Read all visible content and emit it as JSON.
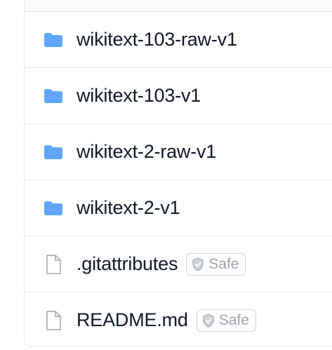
{
  "files": [
    {
      "name": "wikitext-103-raw-v1",
      "type": "folder",
      "icon": "folder-icon"
    },
    {
      "name": "wikitext-103-v1",
      "type": "folder",
      "icon": "folder-icon"
    },
    {
      "name": "wikitext-2-raw-v1",
      "type": "folder",
      "icon": "folder-icon"
    },
    {
      "name": "wikitext-2-v1",
      "type": "folder",
      "icon": "folder-icon"
    },
    {
      "name": ".gitattributes",
      "type": "file",
      "icon": "file-icon",
      "badge": "Safe"
    },
    {
      "name": "README.md",
      "type": "file",
      "icon": "file-icon",
      "badge": "Safe"
    }
  ],
  "colors": {
    "folder": "#60a5fa",
    "file_outline": "#9ca3af",
    "border": "#e5e7eb"
  },
  "badge_icon": "shield-check-icon"
}
